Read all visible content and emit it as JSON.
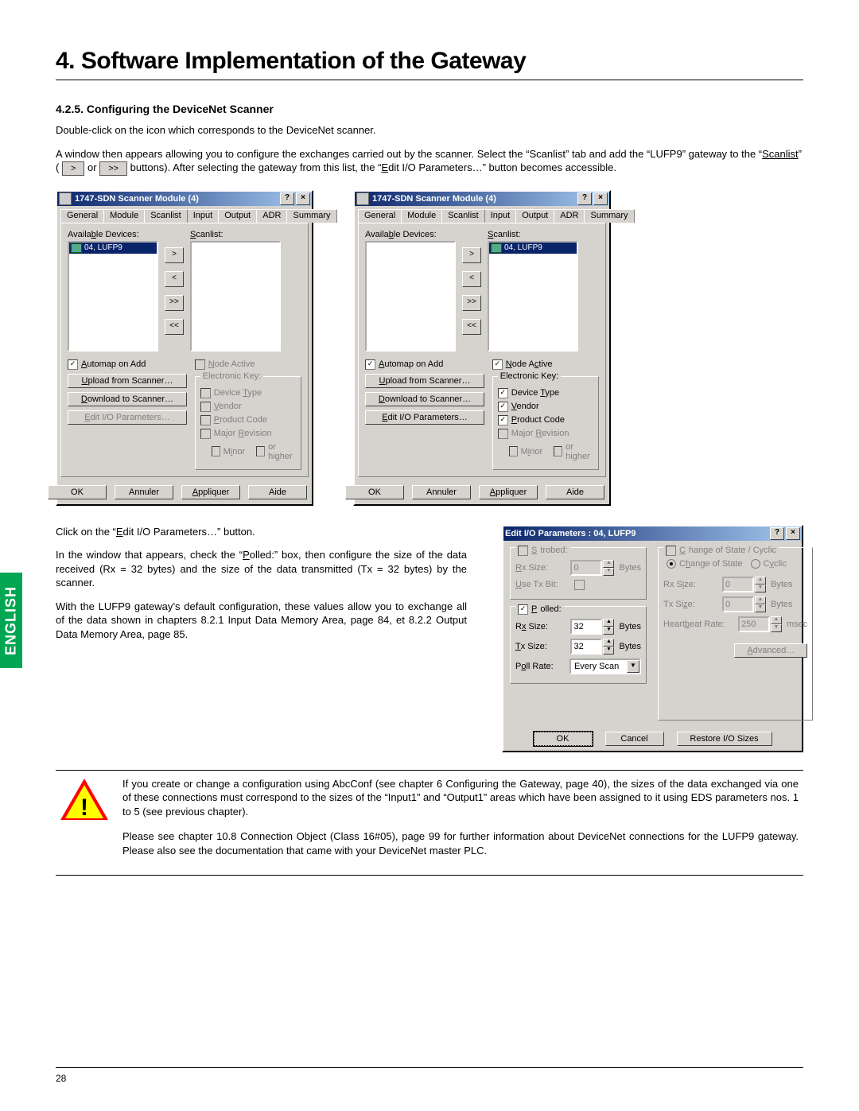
{
  "title": "4. Software Implementation of the Gateway",
  "section": "4.2.5. Configuring the DeviceNet Scanner",
  "intro1": "Double-click on the icon which corresponds to the DeviceNet scanner.",
  "intro2a": "A window then appears allowing you to configure the exchanges carried out by the scanner. Select the “Scanlist” tab and add the “LUFP9” gateway to the “",
  "intro2_scanlist": "Scanlist",
  "intro2b": "” ( ",
  "intro2c": " or ",
  "intro2d": " buttons). After selecting the gateway from this list, the “",
  "intro2_edit": "Edit I/O Parameters…",
  "intro2e": "” button becomes accessible.",
  "btn_gt": ">",
  "btn_gtgt": ">>",
  "dialog": {
    "title": "1747-SDN Scanner Module (4)",
    "tabs": [
      "General",
      "Module",
      "Scanlist",
      "Input",
      "Output",
      "ADR",
      "Summary"
    ],
    "available_label": "Available Devices:",
    "scanlist_label": "Scanlist:",
    "device_item": "04, LUFP9",
    "arrows": [
      ">",
      "<",
      ">>",
      "<<"
    ],
    "automap": "Automap on Add",
    "upload": "Upload from Scanner…",
    "download": "Download to Scanner…",
    "editio": "Edit I/O Parameters…",
    "node_active": "Node Active",
    "ekey": "Electronic Key:",
    "devtype": "Device Type",
    "vendor": "Vendor",
    "prodcode": "Product Code",
    "majrev": "Major Revision",
    "minor": "Minor",
    "orhigher": "or higher",
    "ok": "OK",
    "cancel": "Annuler",
    "apply": "Appliquer",
    "help": "Aide"
  },
  "para_click": "Click on the “Edit I/O Parameters…” button.",
  "para_polled": "In the window that appears, check the “Polled:” box, then configure the size of the data received (Rx = 32 bytes) and the size of the data transmitted (Tx = 32 bytes) by the scanner.",
  "para_default": "With the LUFP9 gateway’s default configuration, these values allow you to exchange all of the data shown in chapters 8.2.1 Input Data Memory Area, page 84, et 8.2.2 Output Data Memory Area, page 85.",
  "editio": {
    "title": "Edit I/O Parameters : 04, LUFP9",
    "strobed": "Strobed:",
    "rxsize": "Rx Size:",
    "txsize": "Tx Size:",
    "usetxbit": "Use Tx Bit:",
    "bytes": "Bytes",
    "polled": "Polled:",
    "pollrate": "Poll Rate:",
    "pollrate_val": "Every Scan",
    "cos": "Change of State / Cyclic",
    "cos_opt1": "Change of State",
    "cos_opt2": "Cyclic",
    "hb": "Heartbeat Rate:",
    "msec": "msec",
    "adv": "Advanced…",
    "rx32": "32",
    "tx32": "32",
    "zero": "0",
    "hb_val": "250",
    "ok": "OK",
    "cancel": "Cancel",
    "restore": "Restore I/O Sizes"
  },
  "warn1": "If you create or change a configuration using AbcConf (see chapter 6 Configuring the Gateway, page 40), the sizes of the data exchanged via one of these connections must correspond to the sizes of the “Input1” and “Output1” areas which have been assigned to it using EDS parameters nos. 1 to 5 (see previous chapter).",
  "warn2": "Please see chapter 10.8 Connection Object (Class 16#05), page 99 for further information about DeviceNet connections for the LUFP9 gateway. Please also see the documentation that came with your DeviceNet master PLC.",
  "sidebar": "ENGLISH",
  "pagenum": "28"
}
